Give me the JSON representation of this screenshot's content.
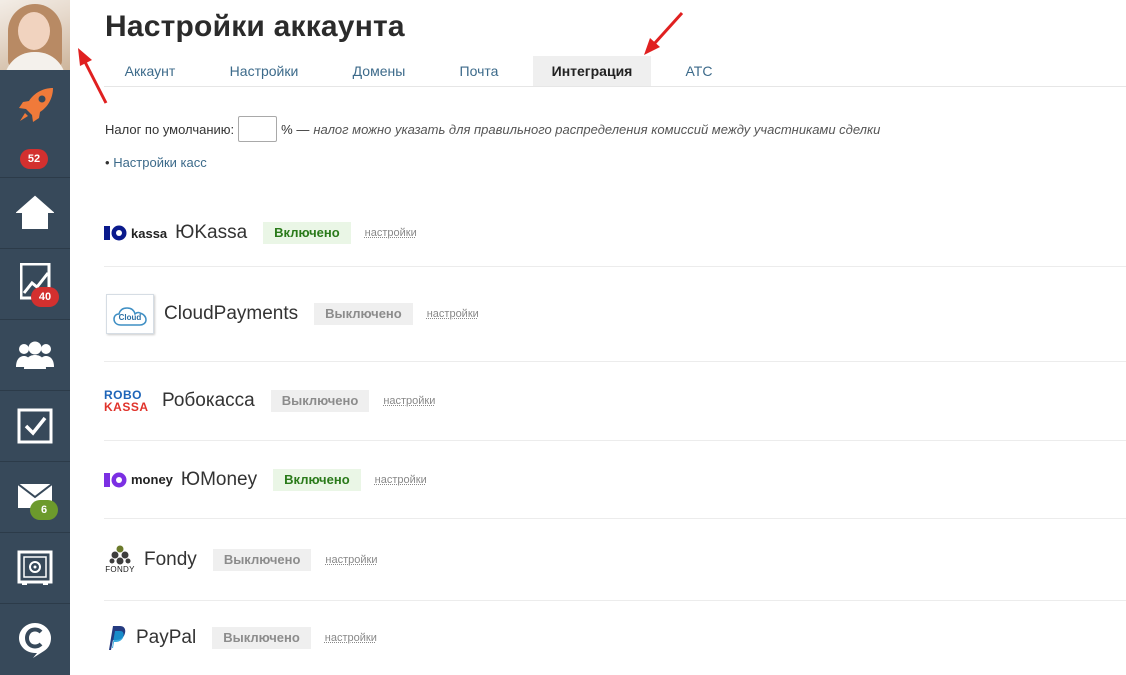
{
  "page": {
    "title": "Настройки аккаунта"
  },
  "tabs": [
    {
      "label": "Аккаунт",
      "active": false
    },
    {
      "label": "Настройки",
      "active": false
    },
    {
      "label": "Домены",
      "active": false
    },
    {
      "label": "Почта",
      "active": false
    },
    {
      "label": "Интеграция",
      "active": true
    },
    {
      "label": "АТС",
      "active": false
    }
  ],
  "sidebar": {
    "items": [
      {
        "icon": "rocket-icon",
        "badge": "52",
        "badge_color": "#d3302f"
      },
      {
        "icon": "home-icon"
      },
      {
        "icon": "chart-icon",
        "badge": "40",
        "badge_color": "#d3302f"
      },
      {
        "icon": "users-icon"
      },
      {
        "icon": "checkbox-icon"
      },
      {
        "icon": "mail-icon",
        "badge": "6",
        "badge_color": "#6c9a2c"
      },
      {
        "icon": "safe-icon"
      },
      {
        "icon": "support-chat-icon"
      }
    ]
  },
  "tax": {
    "label": "Налог по умолчанию:",
    "value": "",
    "unit": "% —",
    "note": "налог можно указать для правильного распределения комиссий между участниками сделки"
  },
  "kassa_link": {
    "bullet": "•",
    "label": "Настройки касс"
  },
  "integrations": [
    {
      "logo_text": "kassa",
      "name": "ЮKassa",
      "status": "Включено",
      "enabled": true,
      "settings": "настройки"
    },
    {
      "logo_text": "Cloud",
      "name": "CloudPayments",
      "status": "Выключено",
      "enabled": false,
      "settings": "настройки"
    },
    {
      "logo_text": "ROBO KASSA",
      "name": "Робокасса",
      "status": "Выключено",
      "enabled": false,
      "settings": "настройки"
    },
    {
      "logo_text": "money",
      "name": "ЮMoney",
      "status": "Включено",
      "enabled": true,
      "settings": "настройки"
    },
    {
      "logo_text": "FONDY",
      "name": "Fondy",
      "status": "Выключено",
      "enabled": false,
      "settings": "настройки"
    },
    {
      "logo_text": "",
      "name": "PayPal",
      "status": "Выключено",
      "enabled": false,
      "settings": "настройки"
    }
  ],
  "colors": {
    "sidebar_bg": "#37495a",
    "link": "#3c6a8a",
    "status_on_text": "#2a7a1a",
    "status_on_bg": "#eaf6e6",
    "status_off_text": "#8c8c8c",
    "status_off_bg": "#efefef",
    "annotation_arrow": "#e02020"
  }
}
